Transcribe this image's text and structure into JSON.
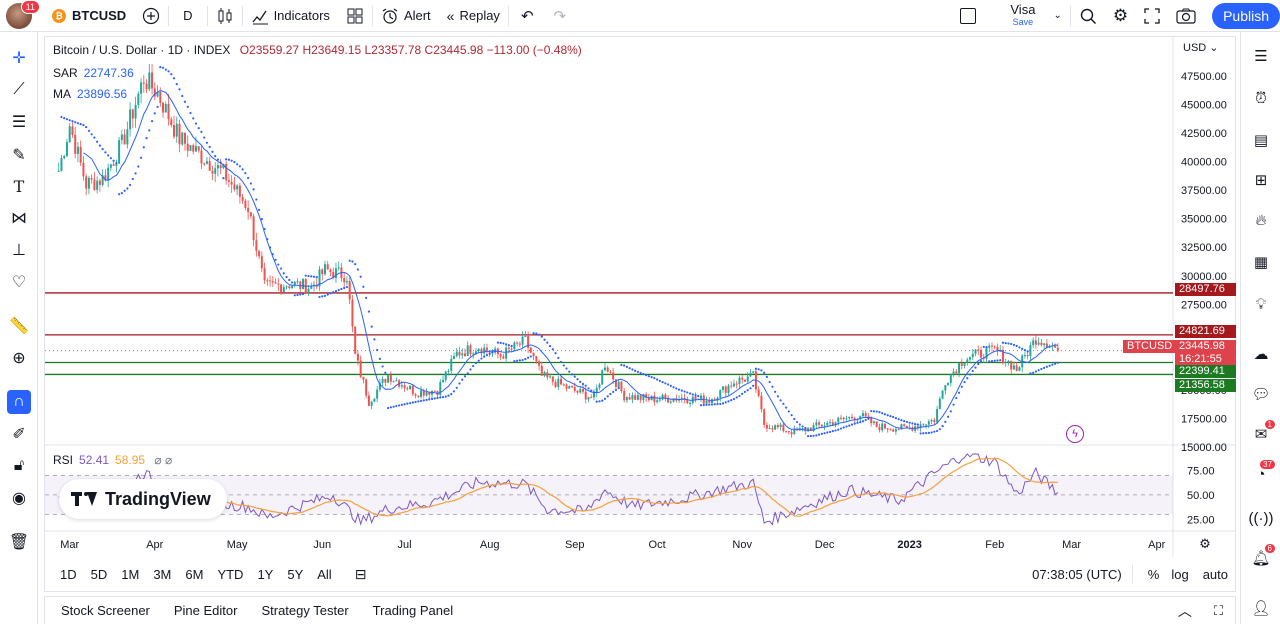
{
  "topbar": {
    "notifications": "11",
    "symbol": "BTCUSD",
    "interval": "D",
    "indicators": "Indicators",
    "alert": "Alert",
    "replay": "Replay",
    "layout_name": "Visa",
    "layout_save": "Save",
    "publish": "Publish"
  },
  "legend": {
    "title": "Bitcoin / U.S. Dollar · 1D · INDEX",
    "ohlc": "O23559.27 H23649.15 L23357.78 C23445.98 −113.00 (−0.48%)",
    "sar_label": "SAR",
    "sar_value": "22747.36",
    "ma_label": "MA",
    "ma_value": "23896.56",
    "rsi_label": "RSI",
    "rsi_value": "52.41",
    "rsi_ma_value": "58.95",
    "brand": "TradingView"
  },
  "currency": "USD",
  "price_labels": {
    "symbol_tag": "BTCUSD",
    "level1": "28497.76",
    "level2": "24821.69",
    "last": "23445.98",
    "countdown": "16:21:55",
    "level3": "22399.41",
    "level4": "21356.58"
  },
  "colors": {
    "accent": "#2962ff",
    "up": "#26a69a",
    "down": "#ef5350",
    "red_level": "#a5191d",
    "green_level": "#1b7a22",
    "sar": "#2962ff",
    "ma": "#2962ff",
    "rsi": "#7e57c2",
    "rsi_ma": "#f7a03b"
  },
  "bottombar": {
    "ranges": [
      "1D",
      "5D",
      "1M",
      "3M",
      "6M",
      "YTD",
      "1Y",
      "5Y",
      "All"
    ],
    "time": "07:38:05 (UTC)",
    "percent": "%",
    "log": "log",
    "auto": "auto"
  },
  "panels": [
    "Stock Screener",
    "Pine Editor",
    "Strategy Tester",
    "Trading Panel"
  ],
  "right_badges": {
    "chat": "1",
    "ideas": "37",
    "notifications": "6"
  },
  "chart_data": {
    "type": "candlestick",
    "ylim": [
      15000,
      48500
    ],
    "yticks": [
      15000,
      17500,
      20000,
      22500,
      25000,
      27500,
      30000,
      32500,
      35000,
      37500,
      40000,
      42500,
      45000,
      47500
    ],
    "ytick_labels": [
      "15000.00",
      "17500.00",
      "20000.00",
      "22500.00",
      "25000.00",
      "27500.00",
      "30000.00",
      "32500.00",
      "35000.00",
      "37500.00",
      "40000.00",
      "42500.00",
      "45000.00",
      "47500.00"
    ],
    "xticks": [
      "Mar",
      "Apr",
      "May",
      "Jun",
      "Jul",
      "Aug",
      "Sep",
      "Oct",
      "Nov",
      "Dec",
      "2023",
      "Feb",
      "Mar",
      "Apr"
    ],
    "horizontal_levels": [
      {
        "value": 28497.76,
        "color": "red"
      },
      {
        "value": 24821.69,
        "color": "red"
      },
      {
        "value": 22399.41,
        "color": "green"
      },
      {
        "value": 21356.58,
        "color": "green"
      }
    ],
    "price_path": [
      [
        "2022-02-25",
        39200
      ],
      [
        "2022-03-01",
        43200
      ],
      [
        "2022-03-07",
        38000
      ],
      [
        "2022-03-13",
        38500
      ],
      [
        "2022-03-20",
        41500
      ],
      [
        "2022-03-28",
        47300
      ],
      [
        "2022-04-02",
        46000
      ],
      [
        "2022-04-10",
        42000
      ],
      [
        "2022-04-18",
        40500
      ],
      [
        "2022-04-26",
        39000
      ],
      [
        "2022-05-05",
        36000
      ],
      [
        "2022-05-11",
        29000
      ],
      [
        "2022-05-20",
        29300
      ],
      [
        "2022-05-28",
        29000
      ],
      [
        "2022-06-02",
        30500
      ],
      [
        "2022-06-10",
        30000
      ],
      [
        "2022-06-13",
        23000
      ],
      [
        "2022-06-18",
        19000
      ],
      [
        "2022-06-25",
        21300
      ],
      [
        "2022-07-05",
        19800
      ],
      [
        "2022-07-13",
        20000
      ],
      [
        "2022-07-20",
        23200
      ],
      [
        "2022-07-28",
        23800
      ],
      [
        "2022-08-05",
        23000
      ],
      [
        "2022-08-14",
        24300
      ],
      [
        "2022-08-20",
        21200
      ],
      [
        "2022-08-31",
        20000
      ],
      [
        "2022-09-08",
        19300
      ],
      [
        "2022-09-12",
        22300
      ],
      [
        "2022-09-19",
        19500
      ],
      [
        "2022-09-28",
        19200
      ],
      [
        "2022-10-10",
        19300
      ],
      [
        "2022-10-20",
        19100
      ],
      [
        "2022-10-29",
        20700
      ],
      [
        "2022-11-05",
        21200
      ],
      [
        "2022-11-09",
        17000
      ],
      [
        "2022-11-20",
        16300
      ],
      [
        "2022-12-01",
        17000
      ],
      [
        "2022-12-14",
        17800
      ],
      [
        "2022-12-20",
        16800
      ],
      [
        "2022-12-31",
        16600
      ],
      [
        "2023-01-10",
        17400
      ],
      [
        "2023-01-14",
        20800
      ],
      [
        "2023-01-21",
        22800
      ],
      [
        "2023-02-01",
        23500
      ],
      [
        "2023-02-09",
        21800
      ],
      [
        "2023-02-16",
        24500
      ],
      [
        "2023-02-21",
        24100
      ],
      [
        "2023-02-24",
        23446
      ]
    ],
    "rsi_ylim": [
      15,
      95
    ],
    "rsi_levels": [
      70,
      50,
      30
    ],
    "rsi_tick_labels": [
      "75.00",
      "50.00",
      "25.00"
    ],
    "rsi_path": [
      [
        "2022-02-25",
        45
      ],
      [
        "2022-03-05",
        41
      ],
      [
        "2022-03-15",
        48
      ],
      [
        "2022-03-28",
        72
      ],
      [
        "2022-04-05",
        58
      ],
      [
        "2022-04-20",
        42
      ],
      [
        "2022-05-05",
        38
      ],
      [
        "2022-05-12",
        27
      ],
      [
        "2022-05-25",
        40
      ],
      [
        "2022-06-05",
        50
      ],
      [
        "2022-06-15",
        22
      ],
      [
        "2022-06-25",
        36
      ],
      [
        "2022-07-10",
        42
      ],
      [
        "2022-07-28",
        63
      ],
      [
        "2022-08-14",
        61
      ],
      [
        "2022-08-22",
        35
      ],
      [
        "2022-09-05",
        33
      ],
      [
        "2022-09-12",
        55
      ],
      [
        "2022-09-22",
        38
      ],
      [
        "2022-10-10",
        46
      ],
      [
        "2022-10-28",
        58
      ],
      [
        "2022-11-05",
        62
      ],
      [
        "2022-11-09",
        22
      ],
      [
        "2022-11-25",
        40
      ],
      [
        "2022-12-10",
        55
      ],
      [
        "2022-12-28",
        44
      ],
      [
        "2023-01-10",
        72
      ],
      [
        "2023-01-21",
        92
      ],
      [
        "2023-02-01",
        84
      ],
      [
        "2023-02-09",
        51
      ],
      [
        "2023-02-16",
        72
      ],
      [
        "2023-02-24",
        52
      ]
    ]
  }
}
